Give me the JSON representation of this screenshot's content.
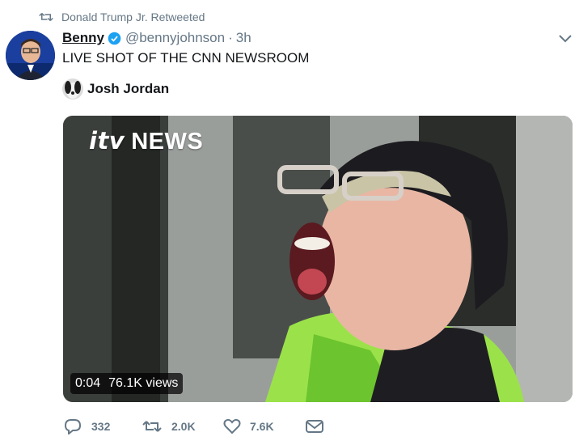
{
  "retweet": {
    "icon": "retweet-icon",
    "text": "Donald Trump Jr. Retweeted"
  },
  "tweet": {
    "author_name": "Benny",
    "verified_icon": "verified-badge-icon",
    "handle": "@bennyjohnson",
    "separator": "·",
    "time": "3h",
    "text": "LIVE SHOT OF THE CNN NEWSROOM",
    "quote_user": "Josh Jordan"
  },
  "media": {
    "logo_prefix": "itv",
    "logo_text": "NEWS",
    "duration": "0:04",
    "views": "76.1K views"
  },
  "actions": {
    "replies": "332",
    "retweets": "2.0K",
    "likes": "7.6K"
  },
  "colors": {
    "accent": "#1da1f2",
    "muted": "#657786",
    "text": "#14171a"
  }
}
